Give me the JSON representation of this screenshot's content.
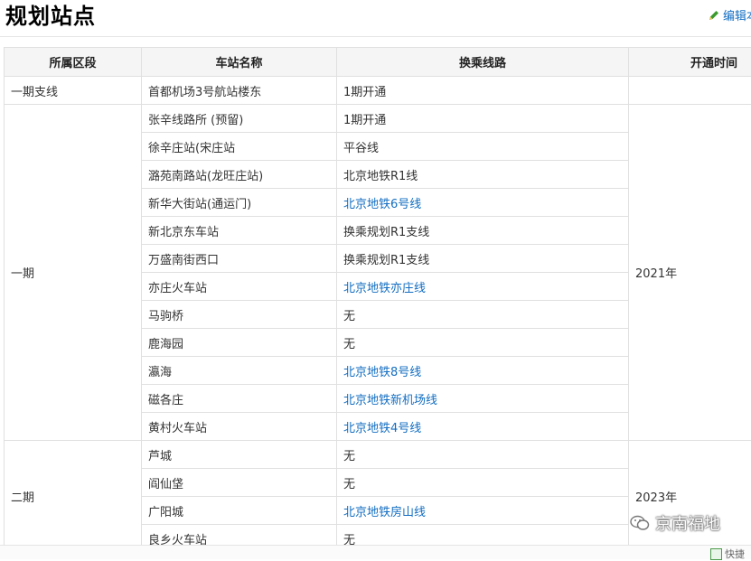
{
  "page": {
    "title": "规划站点",
    "edit_label": "编辑本",
    "bottom_label": "快捷"
  },
  "table": {
    "headers": {
      "section": "所属区段",
      "station": "车站名称",
      "transfer": "换乘线路",
      "open_time": "开通时间"
    },
    "rows": [
      {
        "section": "一期支线",
        "station": "首都机场3号航站楼东",
        "transfer": "1期开通",
        "open_time": ""
      },
      {
        "section": "一期",
        "station": "张辛线路所 (预留)",
        "transfer": "1期开通",
        "open_time": "2021年"
      },
      {
        "station": "徐辛庄站(宋庄站",
        "transfer": "平谷线"
      },
      {
        "station": "潞苑南路站(龙旺庄站)",
        "transfer": "北京地铁R1线"
      },
      {
        "station": "新华大街站(通运门)",
        "transfer": "北京地铁6号线"
      },
      {
        "station": "新北京东车站",
        "transfer": "换乘规划R1支线"
      },
      {
        "station": "万盛南街西口",
        "transfer": "换乘规划R1支线"
      },
      {
        "station": "亦庄火车站",
        "transfer": "北京地铁亦庄线"
      },
      {
        "station": "马驹桥",
        "transfer": "无"
      },
      {
        "station": "鹿海园",
        "transfer": "无"
      },
      {
        "station": "瀛海",
        "transfer": "北京地铁8号线"
      },
      {
        "station": "磁各庄",
        "transfer": "北京地铁新机场线"
      },
      {
        "station": "黄村火车站",
        "transfer": "北京地铁4号线"
      },
      {
        "section": "二期",
        "station": "芦城",
        "transfer": "无",
        "open_time": "2023年"
      },
      {
        "station": "阎仙垡",
        "transfer": "无"
      },
      {
        "station": "广阳城",
        "transfer": "北京地铁房山线"
      },
      {
        "station": "良乡火车站",
        "transfer": "无"
      }
    ]
  },
  "watermark": {
    "text": "京南福地"
  },
  "colors": {
    "link": "#136ec2",
    "header_bg": "#f5f5f5",
    "border": "#e0e0e0"
  }
}
